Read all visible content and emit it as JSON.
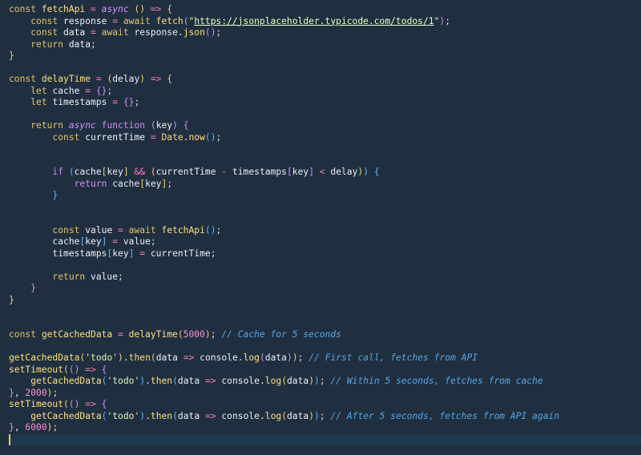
{
  "editor": {
    "lines": [
      [
        {
          "c": "t-kw2",
          "t": "const "
        },
        {
          "c": "t-fn",
          "t": "fetchApi"
        },
        {
          "c": "t-op",
          "t": " = "
        },
        {
          "c": "t-async",
          "t": "async"
        },
        {
          "c": "t-pu",
          "t": " "
        },
        {
          "c": "t-br1",
          "t": "()"
        },
        {
          "c": "t-op",
          "t": " => "
        },
        {
          "c": "t-br1",
          "t": "{"
        }
      ],
      [
        {
          "c": "t-pu",
          "t": "    "
        },
        {
          "c": "t-kw2",
          "t": "const "
        },
        {
          "c": "t-id",
          "t": "response"
        },
        {
          "c": "t-op",
          "t": " = "
        },
        {
          "c": "t-kw2",
          "t": "await "
        },
        {
          "c": "t-fn",
          "t": "fetch"
        },
        {
          "c": "t-br2",
          "t": "("
        },
        {
          "c": "t-str",
          "t": "\""
        },
        {
          "c": "t-url",
          "t": "https://jsonplaceholder.typicode.com/todos/1"
        },
        {
          "c": "t-str",
          "t": "\""
        },
        {
          "c": "t-br2",
          "t": ")"
        },
        {
          "c": "t-pu",
          "t": ";"
        }
      ],
      [
        {
          "c": "t-pu",
          "t": "    "
        },
        {
          "c": "t-kw2",
          "t": "const "
        },
        {
          "c": "t-id",
          "t": "data"
        },
        {
          "c": "t-op",
          "t": " = "
        },
        {
          "c": "t-kw2",
          "t": "await "
        },
        {
          "c": "t-id",
          "t": "response."
        },
        {
          "c": "t-fn",
          "t": "json"
        },
        {
          "c": "t-br2",
          "t": "()"
        },
        {
          "c": "t-pu",
          "t": ";"
        }
      ],
      [
        {
          "c": "t-pu",
          "t": "    "
        },
        {
          "c": "t-kw2",
          "t": "return "
        },
        {
          "c": "t-id",
          "t": "data"
        },
        {
          "c": "t-pu",
          "t": ";"
        }
      ],
      [
        {
          "c": "t-br1",
          "t": "}"
        }
      ],
      [],
      [
        {
          "c": "t-kw2",
          "t": "const "
        },
        {
          "c": "t-fn",
          "t": "delayTime"
        },
        {
          "c": "t-op",
          "t": " = "
        },
        {
          "c": "t-br1",
          "t": "("
        },
        {
          "c": "t-id",
          "t": "delay"
        },
        {
          "c": "t-br1",
          "t": ")"
        },
        {
          "c": "t-op",
          "t": " => "
        },
        {
          "c": "t-br1",
          "t": "{"
        }
      ],
      [
        {
          "c": "t-pu",
          "t": "    "
        },
        {
          "c": "t-kw2",
          "t": "let "
        },
        {
          "c": "t-id",
          "t": "cache"
        },
        {
          "c": "t-op",
          "t": " = "
        },
        {
          "c": "t-br2",
          "t": "{}"
        },
        {
          "c": "t-pu",
          "t": ";"
        }
      ],
      [
        {
          "c": "t-pu",
          "t": "    "
        },
        {
          "c": "t-kw2",
          "t": "let "
        },
        {
          "c": "t-id",
          "t": "timestamps"
        },
        {
          "c": "t-op",
          "t": " = "
        },
        {
          "c": "t-br2",
          "t": "{}"
        },
        {
          "c": "t-pu",
          "t": ";"
        }
      ],
      [],
      [
        {
          "c": "t-pu",
          "t": "    "
        },
        {
          "c": "t-kw2",
          "t": "return "
        },
        {
          "c": "t-async",
          "t": "async"
        },
        {
          "c": "t-pu",
          "t": " "
        },
        {
          "c": "t-br2",
          "t": "function "
        },
        {
          "c": "t-br2",
          "t": "("
        },
        {
          "c": "t-id",
          "t": "key"
        },
        {
          "c": "t-br2",
          "t": ")"
        },
        {
          "c": "t-pu",
          "t": " "
        },
        {
          "c": "t-br2",
          "t": "{"
        }
      ],
      [
        {
          "c": "t-pu",
          "t": "        "
        },
        {
          "c": "t-kw2",
          "t": "const "
        },
        {
          "c": "t-id",
          "t": "currentTime"
        },
        {
          "c": "t-op",
          "t": " = "
        },
        {
          "c": "t-cls",
          "t": "Date"
        },
        {
          "c": "t-id",
          "t": "."
        },
        {
          "c": "t-fn",
          "t": "now"
        },
        {
          "c": "t-br3",
          "t": "()"
        },
        {
          "c": "t-pu",
          "t": ";"
        }
      ],
      [],
      [],
      [
        {
          "c": "t-pu",
          "t": "        "
        },
        {
          "c": "t-br2",
          "t": "if "
        },
        {
          "c": "t-br3",
          "t": "("
        },
        {
          "c": "t-id",
          "t": "cache"
        },
        {
          "c": "t-br1",
          "t": "["
        },
        {
          "c": "t-id",
          "t": "key"
        },
        {
          "c": "t-br1",
          "t": "]"
        },
        {
          "c": "t-op",
          "t": " && "
        },
        {
          "c": "t-br1",
          "t": "("
        },
        {
          "c": "t-id",
          "t": "currentTime"
        },
        {
          "c": "t-op",
          "t": " - "
        },
        {
          "c": "t-id",
          "t": "timestamps"
        },
        {
          "c": "t-br2",
          "t": "["
        },
        {
          "c": "t-id",
          "t": "key"
        },
        {
          "c": "t-br2",
          "t": "]"
        },
        {
          "c": "t-op",
          "t": " < "
        },
        {
          "c": "t-id",
          "t": "delay"
        },
        {
          "c": "t-br1",
          "t": ")"
        },
        {
          "c": "t-br3",
          "t": ")"
        },
        {
          "c": "t-pu",
          "t": " "
        },
        {
          "c": "t-br3",
          "t": "{"
        }
      ],
      [
        {
          "c": "t-pu",
          "t": "            "
        },
        {
          "c": "t-br2",
          "t": "return "
        },
        {
          "c": "t-id",
          "t": "cache"
        },
        {
          "c": "t-br1",
          "t": "["
        },
        {
          "c": "t-id",
          "t": "key"
        },
        {
          "c": "t-br1",
          "t": "]"
        },
        {
          "c": "t-pu",
          "t": ";"
        }
      ],
      [
        {
          "c": "t-pu",
          "t": "        "
        },
        {
          "c": "t-br3",
          "t": "}"
        }
      ],
      [],
      [],
      [
        {
          "c": "t-pu",
          "t": "        "
        },
        {
          "c": "t-kw2",
          "t": "const "
        },
        {
          "c": "t-id",
          "t": "value"
        },
        {
          "c": "t-op",
          "t": " = "
        },
        {
          "c": "t-kw2",
          "t": "await "
        },
        {
          "c": "t-fn",
          "t": "fetchApi"
        },
        {
          "c": "t-br3",
          "t": "()"
        },
        {
          "c": "t-pu",
          "t": ";"
        }
      ],
      [
        {
          "c": "t-pu",
          "t": "        "
        },
        {
          "c": "t-id",
          "t": "cache"
        },
        {
          "c": "t-br3",
          "t": "["
        },
        {
          "c": "t-id",
          "t": "key"
        },
        {
          "c": "t-br3",
          "t": "]"
        },
        {
          "c": "t-op",
          "t": " = "
        },
        {
          "c": "t-id",
          "t": "value"
        },
        {
          "c": "t-pu",
          "t": ";"
        }
      ],
      [
        {
          "c": "t-pu",
          "t": "        "
        },
        {
          "c": "t-id",
          "t": "timestamps"
        },
        {
          "c": "t-br3",
          "t": "["
        },
        {
          "c": "t-id",
          "t": "key"
        },
        {
          "c": "t-br3",
          "t": "]"
        },
        {
          "c": "t-op",
          "t": " = "
        },
        {
          "c": "t-id",
          "t": "currentTime"
        },
        {
          "c": "t-pu",
          "t": ";"
        }
      ],
      [],
      [
        {
          "c": "t-pu",
          "t": "        "
        },
        {
          "c": "t-kw2",
          "t": "return "
        },
        {
          "c": "t-id",
          "t": "value"
        },
        {
          "c": "t-pu",
          "t": ";"
        }
      ],
      [
        {
          "c": "t-pu",
          "t": "    "
        },
        {
          "c": "t-br2",
          "t": "}"
        }
      ],
      [
        {
          "c": "t-br1",
          "t": "}"
        }
      ],
      [],
      [],
      [
        {
          "c": "t-kw2",
          "t": "const "
        },
        {
          "c": "t-fn",
          "t": "getCachedData"
        },
        {
          "c": "t-op",
          "t": " = "
        },
        {
          "c": "t-fn",
          "t": "delayTime"
        },
        {
          "c": "t-br1",
          "t": "("
        },
        {
          "c": "t-num",
          "t": "5000"
        },
        {
          "c": "t-br1",
          "t": ")"
        },
        {
          "c": "t-pu",
          "t": "; "
        },
        {
          "c": "t-com",
          "t": "// Cache for 5 seconds"
        }
      ],
      [],
      [
        {
          "c": "t-fn",
          "t": "getCachedData"
        },
        {
          "c": "t-br1",
          "t": "("
        },
        {
          "c": "t-str",
          "t": "'todo'"
        },
        {
          "c": "t-br1",
          "t": ")"
        },
        {
          "c": "t-id",
          "t": "."
        },
        {
          "c": "t-fn",
          "t": "then"
        },
        {
          "c": "t-br1",
          "t": "("
        },
        {
          "c": "t-id",
          "t": "data"
        },
        {
          "c": "t-op",
          "t": " => "
        },
        {
          "c": "t-id",
          "t": "console."
        },
        {
          "c": "t-fn",
          "t": "log"
        },
        {
          "c": "t-br2",
          "t": "("
        },
        {
          "c": "t-id",
          "t": "data"
        },
        {
          "c": "t-br2",
          "t": ")"
        },
        {
          "c": "t-br1",
          "t": ")"
        },
        {
          "c": "t-pu",
          "t": "; "
        },
        {
          "c": "t-com",
          "t": "// First call, fetches from API"
        }
      ],
      [
        {
          "c": "t-fn",
          "t": "setTimeout"
        },
        {
          "c": "t-br1",
          "t": "("
        },
        {
          "c": "t-br2",
          "t": "()"
        },
        {
          "c": "t-op",
          "t": " => "
        },
        {
          "c": "t-br2",
          "t": "{"
        }
      ],
      [
        {
          "c": "t-pu",
          "t": "    "
        },
        {
          "c": "t-fn",
          "t": "getCachedData"
        },
        {
          "c": "t-br3",
          "t": "("
        },
        {
          "c": "t-str",
          "t": "'todo'"
        },
        {
          "c": "t-br3",
          "t": ")"
        },
        {
          "c": "t-id",
          "t": "."
        },
        {
          "c": "t-fn",
          "t": "then"
        },
        {
          "c": "t-br3",
          "t": "("
        },
        {
          "c": "t-id",
          "t": "data"
        },
        {
          "c": "t-op",
          "t": " => "
        },
        {
          "c": "t-id",
          "t": "console."
        },
        {
          "c": "t-fn",
          "t": "log"
        },
        {
          "c": "t-br1",
          "t": "("
        },
        {
          "c": "t-id",
          "t": "data"
        },
        {
          "c": "t-br1",
          "t": ")"
        },
        {
          "c": "t-br3",
          "t": ")"
        },
        {
          "c": "t-pu",
          "t": "; "
        },
        {
          "c": "t-com",
          "t": "// Within 5 seconds, fetches from cache"
        }
      ],
      [
        {
          "c": "t-br2",
          "t": "}"
        },
        {
          "c": "t-pu",
          "t": ", "
        },
        {
          "c": "t-num",
          "t": "2000"
        },
        {
          "c": "t-br1",
          "t": ")"
        },
        {
          "c": "t-pu",
          "t": ";"
        }
      ],
      [
        {
          "c": "t-fn",
          "t": "setTimeout"
        },
        {
          "c": "t-br1",
          "t": "("
        },
        {
          "c": "t-br2",
          "t": "()"
        },
        {
          "c": "t-op",
          "t": " => "
        },
        {
          "c": "t-br2",
          "t": "{"
        }
      ],
      [
        {
          "c": "t-pu",
          "t": "    "
        },
        {
          "c": "t-fn",
          "t": "getCachedData"
        },
        {
          "c": "t-br3",
          "t": "("
        },
        {
          "c": "t-str",
          "t": "'todo'"
        },
        {
          "c": "t-br3",
          "t": ")"
        },
        {
          "c": "t-id",
          "t": "."
        },
        {
          "c": "t-fn",
          "t": "then"
        },
        {
          "c": "t-br3",
          "t": "("
        },
        {
          "c": "t-id",
          "t": "data"
        },
        {
          "c": "t-op",
          "t": " => "
        },
        {
          "c": "t-id",
          "t": "console."
        },
        {
          "c": "t-fn",
          "t": "log"
        },
        {
          "c": "t-br1",
          "t": "("
        },
        {
          "c": "t-id",
          "t": "data"
        },
        {
          "c": "t-br1",
          "t": ")"
        },
        {
          "c": "t-br3",
          "t": ")"
        },
        {
          "c": "t-pu",
          "t": "; "
        },
        {
          "c": "t-com",
          "t": "// After 5 seconds, fetches from API again"
        }
      ],
      [
        {
          "c": "t-br2",
          "t": "}"
        },
        {
          "c": "t-pu",
          "t": ", "
        },
        {
          "c": "t-num",
          "t": "6000"
        },
        {
          "c": "t-br1",
          "t": ")"
        },
        {
          "c": "t-pu",
          "t": ";"
        }
      ],
      []
    ],
    "current_line": 37,
    "indent_guides": [
      {
        "from": 15,
        "to": 16,
        "col": 8
      },
      {
        "from": 32,
        "to": 32,
        "col": 0
      },
      {
        "from": 35,
        "to": 35,
        "col": 0
      }
    ]
  }
}
